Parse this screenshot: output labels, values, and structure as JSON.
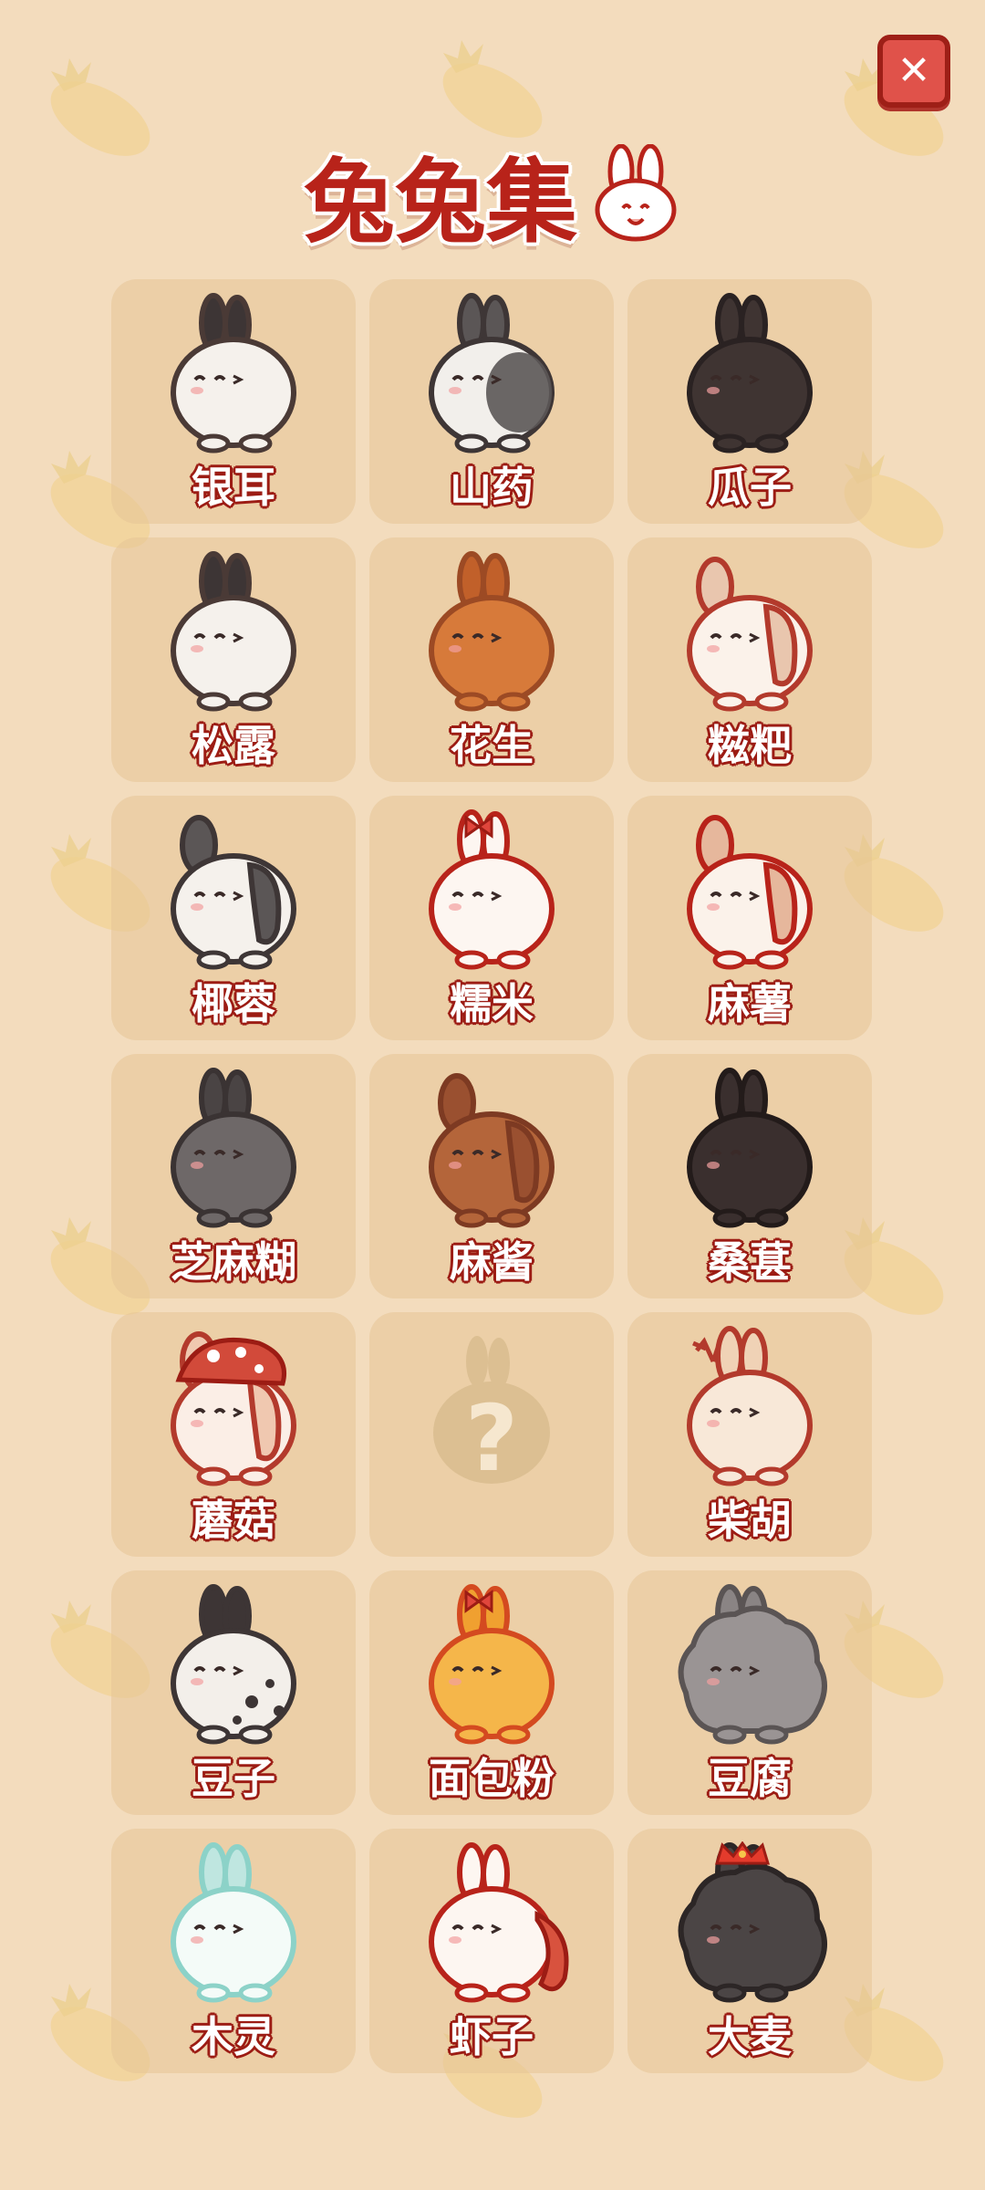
{
  "title": "兔兔集",
  "close_icon": "close-icon",
  "title_icon": "bunny-face-icon",
  "colors": {
    "accent": "#b8231a",
    "background": "#f3dcbd",
    "cell": "#e6c496"
  },
  "rabbits": [
    {
      "name": "银耳",
      "body": "#f5f1ec",
      "ear": "#3d3535",
      "outline": "#4a3a36"
    },
    {
      "name": "山药",
      "body": "#f2efeb",
      "ear": "#5b5656",
      "outline": "#3e3636",
      "patch": "#5b5656"
    },
    {
      "name": "瓜子",
      "body": "#3f3432",
      "ear": "#3f3432",
      "outline": "#2a2222"
    },
    {
      "name": "松露",
      "body": "#f5f1ec",
      "ear": "#3d3535",
      "outline": "#4a3a36"
    },
    {
      "name": "花生",
      "body": "#d77a3a",
      "ear": "#c1602a",
      "outline": "#9c4a24"
    },
    {
      "name": "糍粑",
      "body": "#fbf2ea",
      "ear": "#e9c6ae",
      "outline": "#b33a2c",
      "lop": true
    },
    {
      "name": "椰蓉",
      "body": "#f5f1ec",
      "ear": "#5b5656",
      "outline": "#3e3636",
      "lop": true
    },
    {
      "name": "糯米",
      "body": "#fdf6f1",
      "ear": "#fdf6f1",
      "outline": "#b8231a",
      "bow": true
    },
    {
      "name": "麻薯",
      "body": "#fbf2ea",
      "ear": "#e6b79c",
      "outline": "#b8231a",
      "lop": true
    },
    {
      "name": "芝麻糊",
      "body": "#6e6868",
      "ear": "#4a4444",
      "outline": "#3a3333"
    },
    {
      "name": "麻酱",
      "body": "#b4653a",
      "ear": "#9a5030",
      "outline": "#7d3a22",
      "lop": true
    },
    {
      "name": "桑葚",
      "body": "#3a2f2e",
      "ear": "#3a2f2e",
      "outline": "#231b1a"
    },
    {
      "name": "蘑菇",
      "body": "#fbeee6",
      "ear": "#f0c8b0",
      "outline": "#b33a2c",
      "lop": true,
      "hat": true
    },
    {
      "name": "",
      "locked": true
    },
    {
      "name": "柴胡",
      "body": "#f8e8d8",
      "ear": "#f0d2b6",
      "outline": "#b33a2c",
      "antler": true
    },
    {
      "name": "豆子",
      "body": "#f3efea",
      "ear": "#3d3535",
      "outline": "#3d3535",
      "spots": true
    },
    {
      "name": "面包粉",
      "body": "#f5b64a",
      "ear": "#f0a030",
      "outline": "#d44a20",
      "bow": true
    },
    {
      "name": "豆腐",
      "body": "#9a9494",
      "ear": "#8a8484",
      "outline": "#5a5454",
      "fluffy": true
    },
    {
      "name": "木灵",
      "body": "#f4fbf8",
      "ear": "#bfe6e0",
      "outline": "#8cd2c8"
    },
    {
      "name": "虾子",
      "body": "#fdf6f1",
      "ear": "#fdf6f1",
      "outline": "#b8231a",
      "shrimp": true
    },
    {
      "name": "大麦",
      "body": "#4b4545",
      "ear": "#4b4545",
      "outline": "#2c2626",
      "fluffy": true,
      "crown": true
    }
  ]
}
